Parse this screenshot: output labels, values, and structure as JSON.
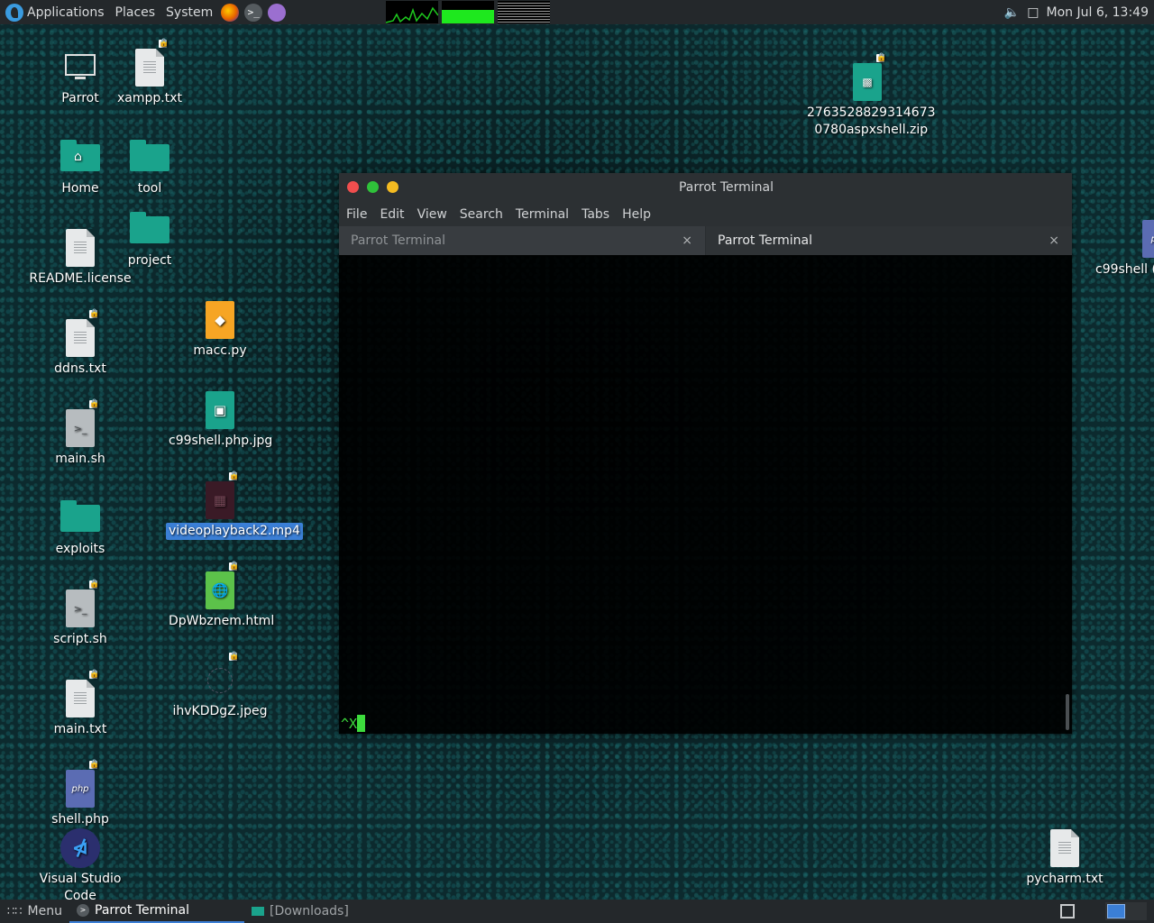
{
  "top_panel": {
    "menus": [
      "Applications",
      "Places",
      "System"
    ],
    "launchers": [
      {
        "icon": "firefox-icon",
        "color": "#e66000"
      },
      {
        "icon": "terminal-icon",
        "color": "#555b5f"
      },
      {
        "icon": "text-editor-icon",
        "color": "#9b6fd0"
      }
    ],
    "datetime": "Mon Jul 6, 13:49"
  },
  "desktop_icons": [
    {
      "label": "Parrot",
      "type": "computer"
    },
    {
      "label": "xampp.txt",
      "type": "text"
    },
    {
      "label": "Home",
      "type": "home-folder"
    },
    {
      "label": "tool",
      "type": "folder"
    },
    {
      "label": "README.license",
      "type": "text"
    },
    {
      "label": "project",
      "type": "folder"
    },
    {
      "label": "ddns.txt",
      "type": "text"
    },
    {
      "label": "macc.py",
      "type": "python"
    },
    {
      "label": "main.sh",
      "type": "shell"
    },
    {
      "label": "c99shell.php.jpg",
      "type": "image"
    },
    {
      "label": "videoplayback2.mp4",
      "type": "video",
      "selected": true
    },
    {
      "label": "exploits",
      "type": "folder"
    },
    {
      "label": "DpWbznem.html",
      "type": "html"
    },
    {
      "label": "script.sh",
      "type": "shell"
    },
    {
      "label": "ihvKDDgZ.jpeg",
      "type": "image-broken"
    },
    {
      "label": "main.txt",
      "type": "text"
    },
    {
      "label": "shell.php",
      "type": "php"
    },
    {
      "label": "Visual Studio Code",
      "type": "vscode"
    },
    {
      "label": "2763528829314673\n0780aspxshell.zip",
      "type": "zip"
    },
    {
      "label": "c99shell (",
      "type": "php"
    },
    {
      "label": "pycharm.txt",
      "type": "text"
    }
  ],
  "terminal": {
    "title": "Parrot Terminal",
    "menu": [
      "File",
      "Edit",
      "View",
      "Search",
      "Terminal",
      "Tabs",
      "Help"
    ],
    "tabs": [
      {
        "label": "Parrot Terminal",
        "active": false
      },
      {
        "label": "Parrot Terminal",
        "active": true
      }
    ],
    "tab_close": "×",
    "output": "^X"
  },
  "bottom_panel": {
    "menu_label": "Menu",
    "tasks": [
      {
        "label": "Parrot Terminal",
        "active": true
      },
      {
        "label": "[Downloads]",
        "active": false
      }
    ]
  }
}
